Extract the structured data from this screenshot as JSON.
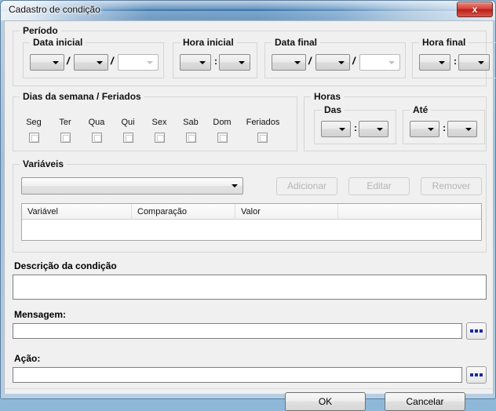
{
  "window": {
    "title": "Cadastro de condição",
    "close_label": "x",
    "close_icon": "close-icon"
  },
  "periodo": {
    "legend": "Período",
    "data_inicial": {
      "legend": "Data inicial",
      "day_value": "",
      "month_value": "",
      "year_value": "",
      "separator": "/"
    },
    "hora_inicial": {
      "legend": "Hora inicial",
      "hour_value": "",
      "minute_value": "",
      "separator": ":"
    },
    "data_final": {
      "legend": "Data final",
      "day_value": "",
      "month_value": "",
      "year_value": "",
      "separator": "/"
    },
    "hora_final": {
      "legend": "Hora final",
      "hour_value": "",
      "minute_value": "",
      "separator": ":"
    }
  },
  "dias_semana": {
    "legend": "Dias da semana / Feriados",
    "days": [
      {
        "label": "Seg",
        "checked": false
      },
      {
        "label": "Ter",
        "checked": false
      },
      {
        "label": "Qua",
        "checked": false
      },
      {
        "label": "Qui",
        "checked": false
      },
      {
        "label": "Sex",
        "checked": false
      },
      {
        "label": "Sab",
        "checked": false
      },
      {
        "label": "Dom",
        "checked": false
      },
      {
        "label": "Feriados",
        "checked": false
      }
    ]
  },
  "horas": {
    "legend": "Horas",
    "das": {
      "legend": "Das",
      "hour_value": "",
      "minute_value": "",
      "separator": ":"
    },
    "ate": {
      "legend": "Até",
      "hour_value": "",
      "minute_value": "",
      "separator": ":"
    }
  },
  "variaveis": {
    "legend": "Variáveis",
    "combo_value": "",
    "buttons": {
      "add": "Adicionar",
      "edit": "Editar",
      "remove": "Remover"
    },
    "table": {
      "columns": [
        "Variável",
        "Comparação",
        "Valor",
        ""
      ],
      "rows": []
    }
  },
  "descricao": {
    "label": "Descrição da condição",
    "value": ""
  },
  "mensagem": {
    "label": "Mensagem:",
    "value": "",
    "browse_icon": "ellipsis-icon"
  },
  "acao": {
    "label": "Ação:",
    "value": "",
    "browse_icon": "ellipsis-icon"
  },
  "footer": {
    "ok": "OK",
    "cancel": "Cancelar"
  },
  "colors": {
    "accent": "#2a6ca8",
    "close_red": "#bb1f17",
    "dialog_bg": "#f0f0f0",
    "dots_blue": "#1b27a8"
  }
}
